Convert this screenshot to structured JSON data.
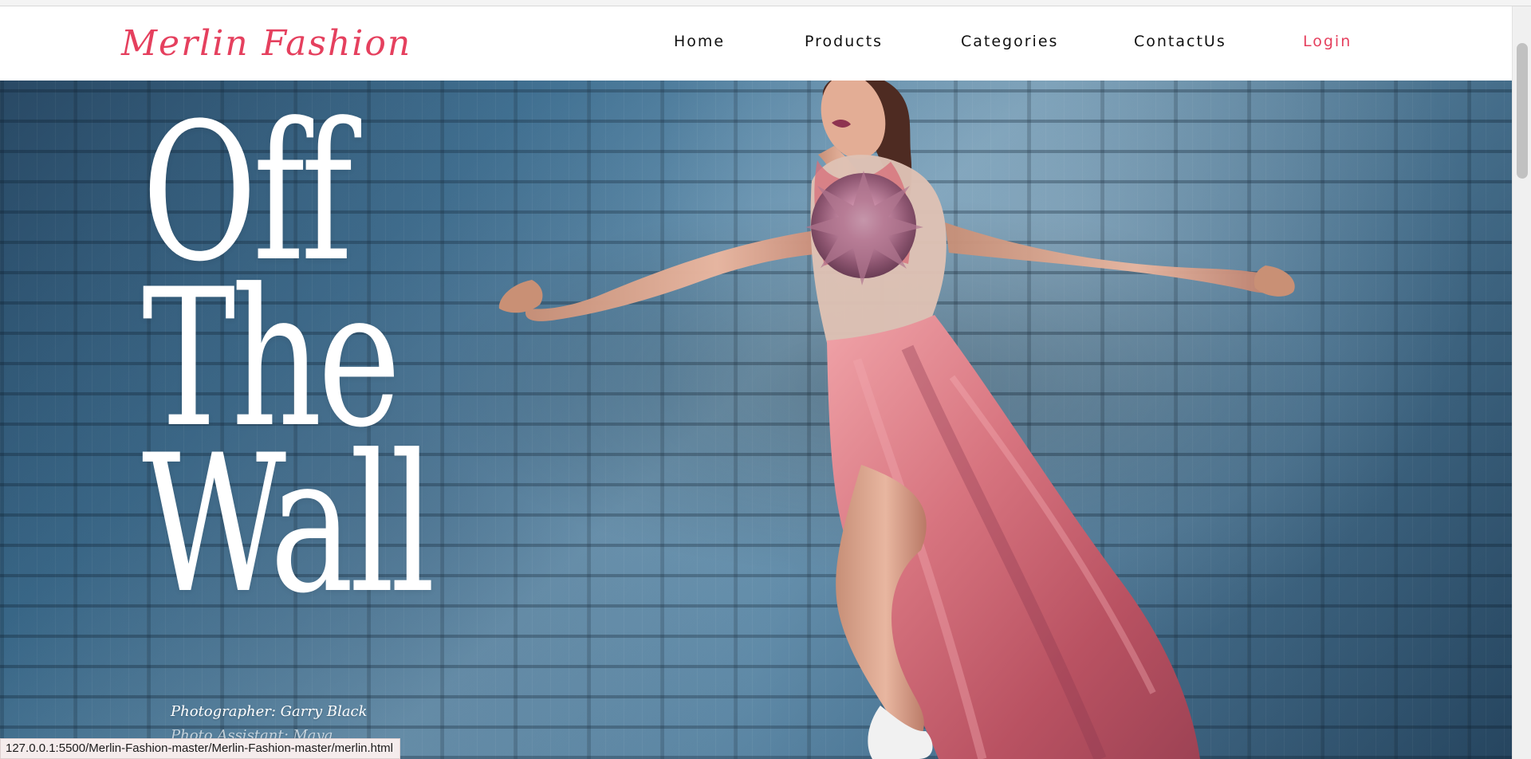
{
  "brand": {
    "name": "Merlin Fashion"
  },
  "navigation": {
    "items": [
      {
        "label": "Home"
      },
      {
        "label": "Products"
      },
      {
        "label": "Categories"
      },
      {
        "label": "ContactUs"
      },
      {
        "label": "Login"
      }
    ]
  },
  "hero": {
    "title_lines": [
      "Off",
      "The",
      "Wall"
    ],
    "photographer": "Photographer: Garry Black",
    "partial_credit": "Photo Assistant: Maya ..."
  },
  "status_bar": {
    "url": "127.0.0.1:5500/Merlin-Fashion-master/Merlin-Fashion-master/merlin.html"
  },
  "colors": {
    "accent": "#e5405e",
    "nav_text": "#111111",
    "hero_text": "#ffffff"
  },
  "icons": {
    "scrollbar": "scrollbar-thumb"
  }
}
